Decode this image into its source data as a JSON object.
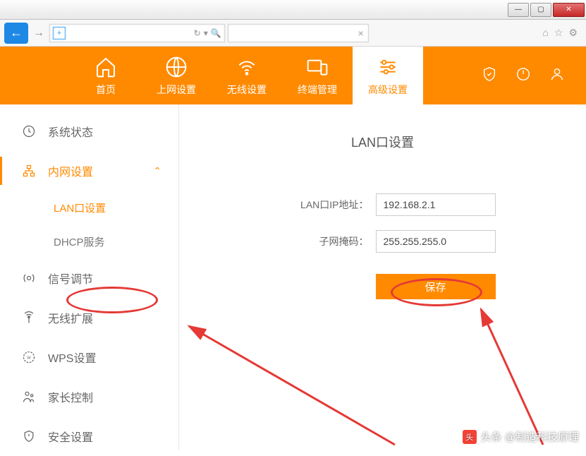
{
  "window": {
    "min": "—",
    "max": "▢",
    "close": "✕"
  },
  "browser": {
    "back": "←",
    "fwd": "→",
    "refresh": "↻",
    "search": "🔍",
    "tab_close": "×",
    "home": "⌂",
    "star": "☆",
    "gear": "⚙"
  },
  "topnav": {
    "items": [
      {
        "label": "首页"
      },
      {
        "label": "上网设置"
      },
      {
        "label": "无线设置"
      },
      {
        "label": "终端管理"
      },
      {
        "label": "高级设置"
      }
    ]
  },
  "sidebar": {
    "items": [
      {
        "label": "系统状态"
      },
      {
        "label": "内网设置",
        "chevron": "⌃"
      },
      {
        "label": "信号调节"
      },
      {
        "label": "无线扩展"
      },
      {
        "label": "WPS设置"
      },
      {
        "label": "家长控制"
      },
      {
        "label": "安全设置"
      }
    ],
    "sub": [
      {
        "label": "LAN口设置"
      },
      {
        "label": "DHCP服务"
      }
    ]
  },
  "content": {
    "title": "LAN口设置",
    "ip_label": "LAN口IP地址：",
    "ip_value": "192.168.2.1",
    "mask_label": "子网掩码：",
    "mask_value": "255.255.255.0",
    "save": "保存"
  },
  "watermark": {
    "text": "头条 @制造科技原理",
    "logo": "头"
  }
}
